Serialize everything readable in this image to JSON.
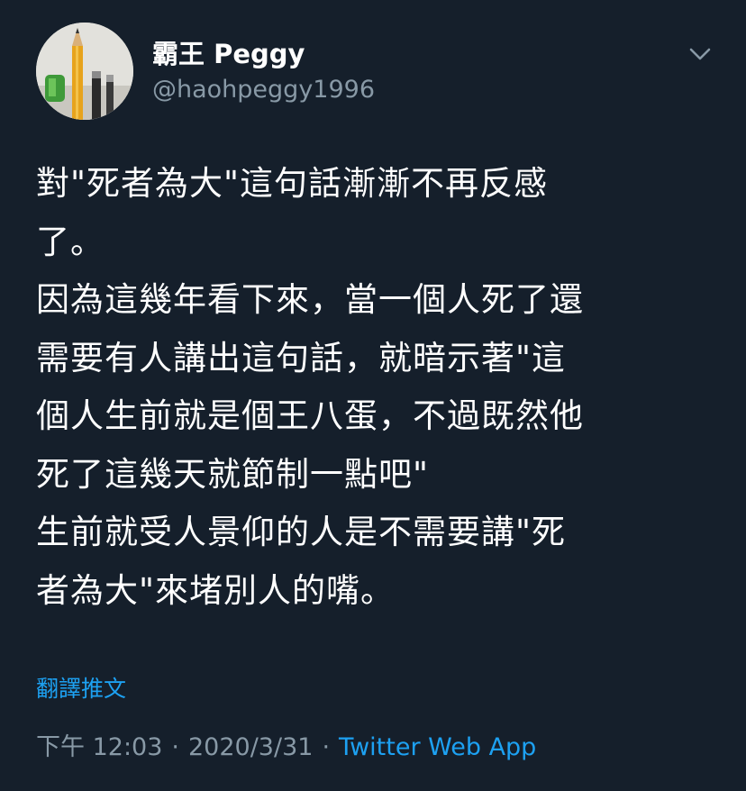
{
  "user": {
    "display_name": "霸王 Peggy",
    "handle": "@haohpeggy1996"
  },
  "tweet": {
    "lines": [
      "對\"死者為大\"這句話漸漸不再反感",
      "了。",
      "因為這幾年看下來，當一個人死了還",
      "需要有人講出這句話，就暗示著\"這",
      "個人生前就是個王八蛋，不過既然他",
      "死了這幾天就節制一點吧\"",
      "生前就受人景仰的人是不需要講\"死",
      "者為大\"來堵別人的嘴。"
    ],
    "translate_label": "翻譯推文"
  },
  "meta": {
    "time": "下午 12:03",
    "separator": "·",
    "date": "2020/3/31",
    "source": "Twitter Web App"
  },
  "icons": {
    "avatar": "pencils-photo",
    "menu": "chevron-down-icon"
  },
  "colors": {
    "background": "#151f2b",
    "text": "#ffffff",
    "secondary": "#8899a6",
    "accent": "#1da1f2"
  }
}
